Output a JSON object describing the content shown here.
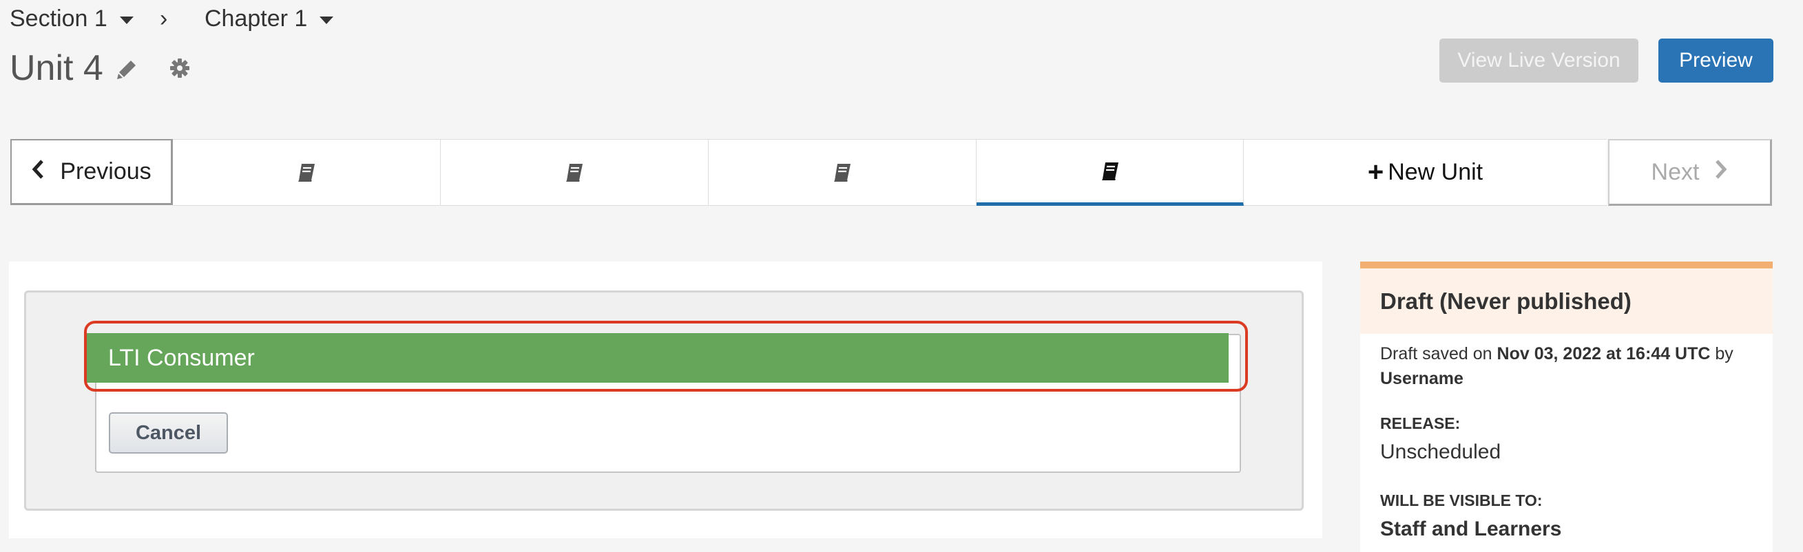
{
  "breadcrumb": {
    "section": "Section 1",
    "chapter": "Chapter 1",
    "separator": "›"
  },
  "unit_title": "Unit 4",
  "header_buttons": {
    "view_live": "View Live Version",
    "preview": "Preview"
  },
  "unit_nav": {
    "previous": "Previous",
    "new_unit": "New Unit",
    "next": "Next",
    "units": [
      {
        "icon": "book-icon",
        "active": false
      },
      {
        "icon": "book-icon",
        "active": false
      },
      {
        "icon": "book-icon",
        "active": false
      },
      {
        "icon": "book-icon",
        "active": true
      }
    ]
  },
  "component_picker": {
    "item": "LTI Consumer",
    "cancel": "Cancel"
  },
  "sidebar": {
    "status": "Draft (Never published)",
    "saved_prefix": "Draft saved on",
    "saved_date": "Nov 03, 2022 at 16:44 UTC",
    "saved_by": "by",
    "username": "Username",
    "release_label": "RELEASE:",
    "release_value": "Unscheduled",
    "visible_label": "WILL BE VISIBLE TO:",
    "visible_value": "Staff and Learners"
  },
  "colors": {
    "primary": "#2a74b6",
    "active_tab": "#1f6ea9",
    "component_green": "#66a65a",
    "highlight": "#dc3b23",
    "draft_accent": "#f3ae72",
    "draft_bg": "#fdf1e8"
  }
}
